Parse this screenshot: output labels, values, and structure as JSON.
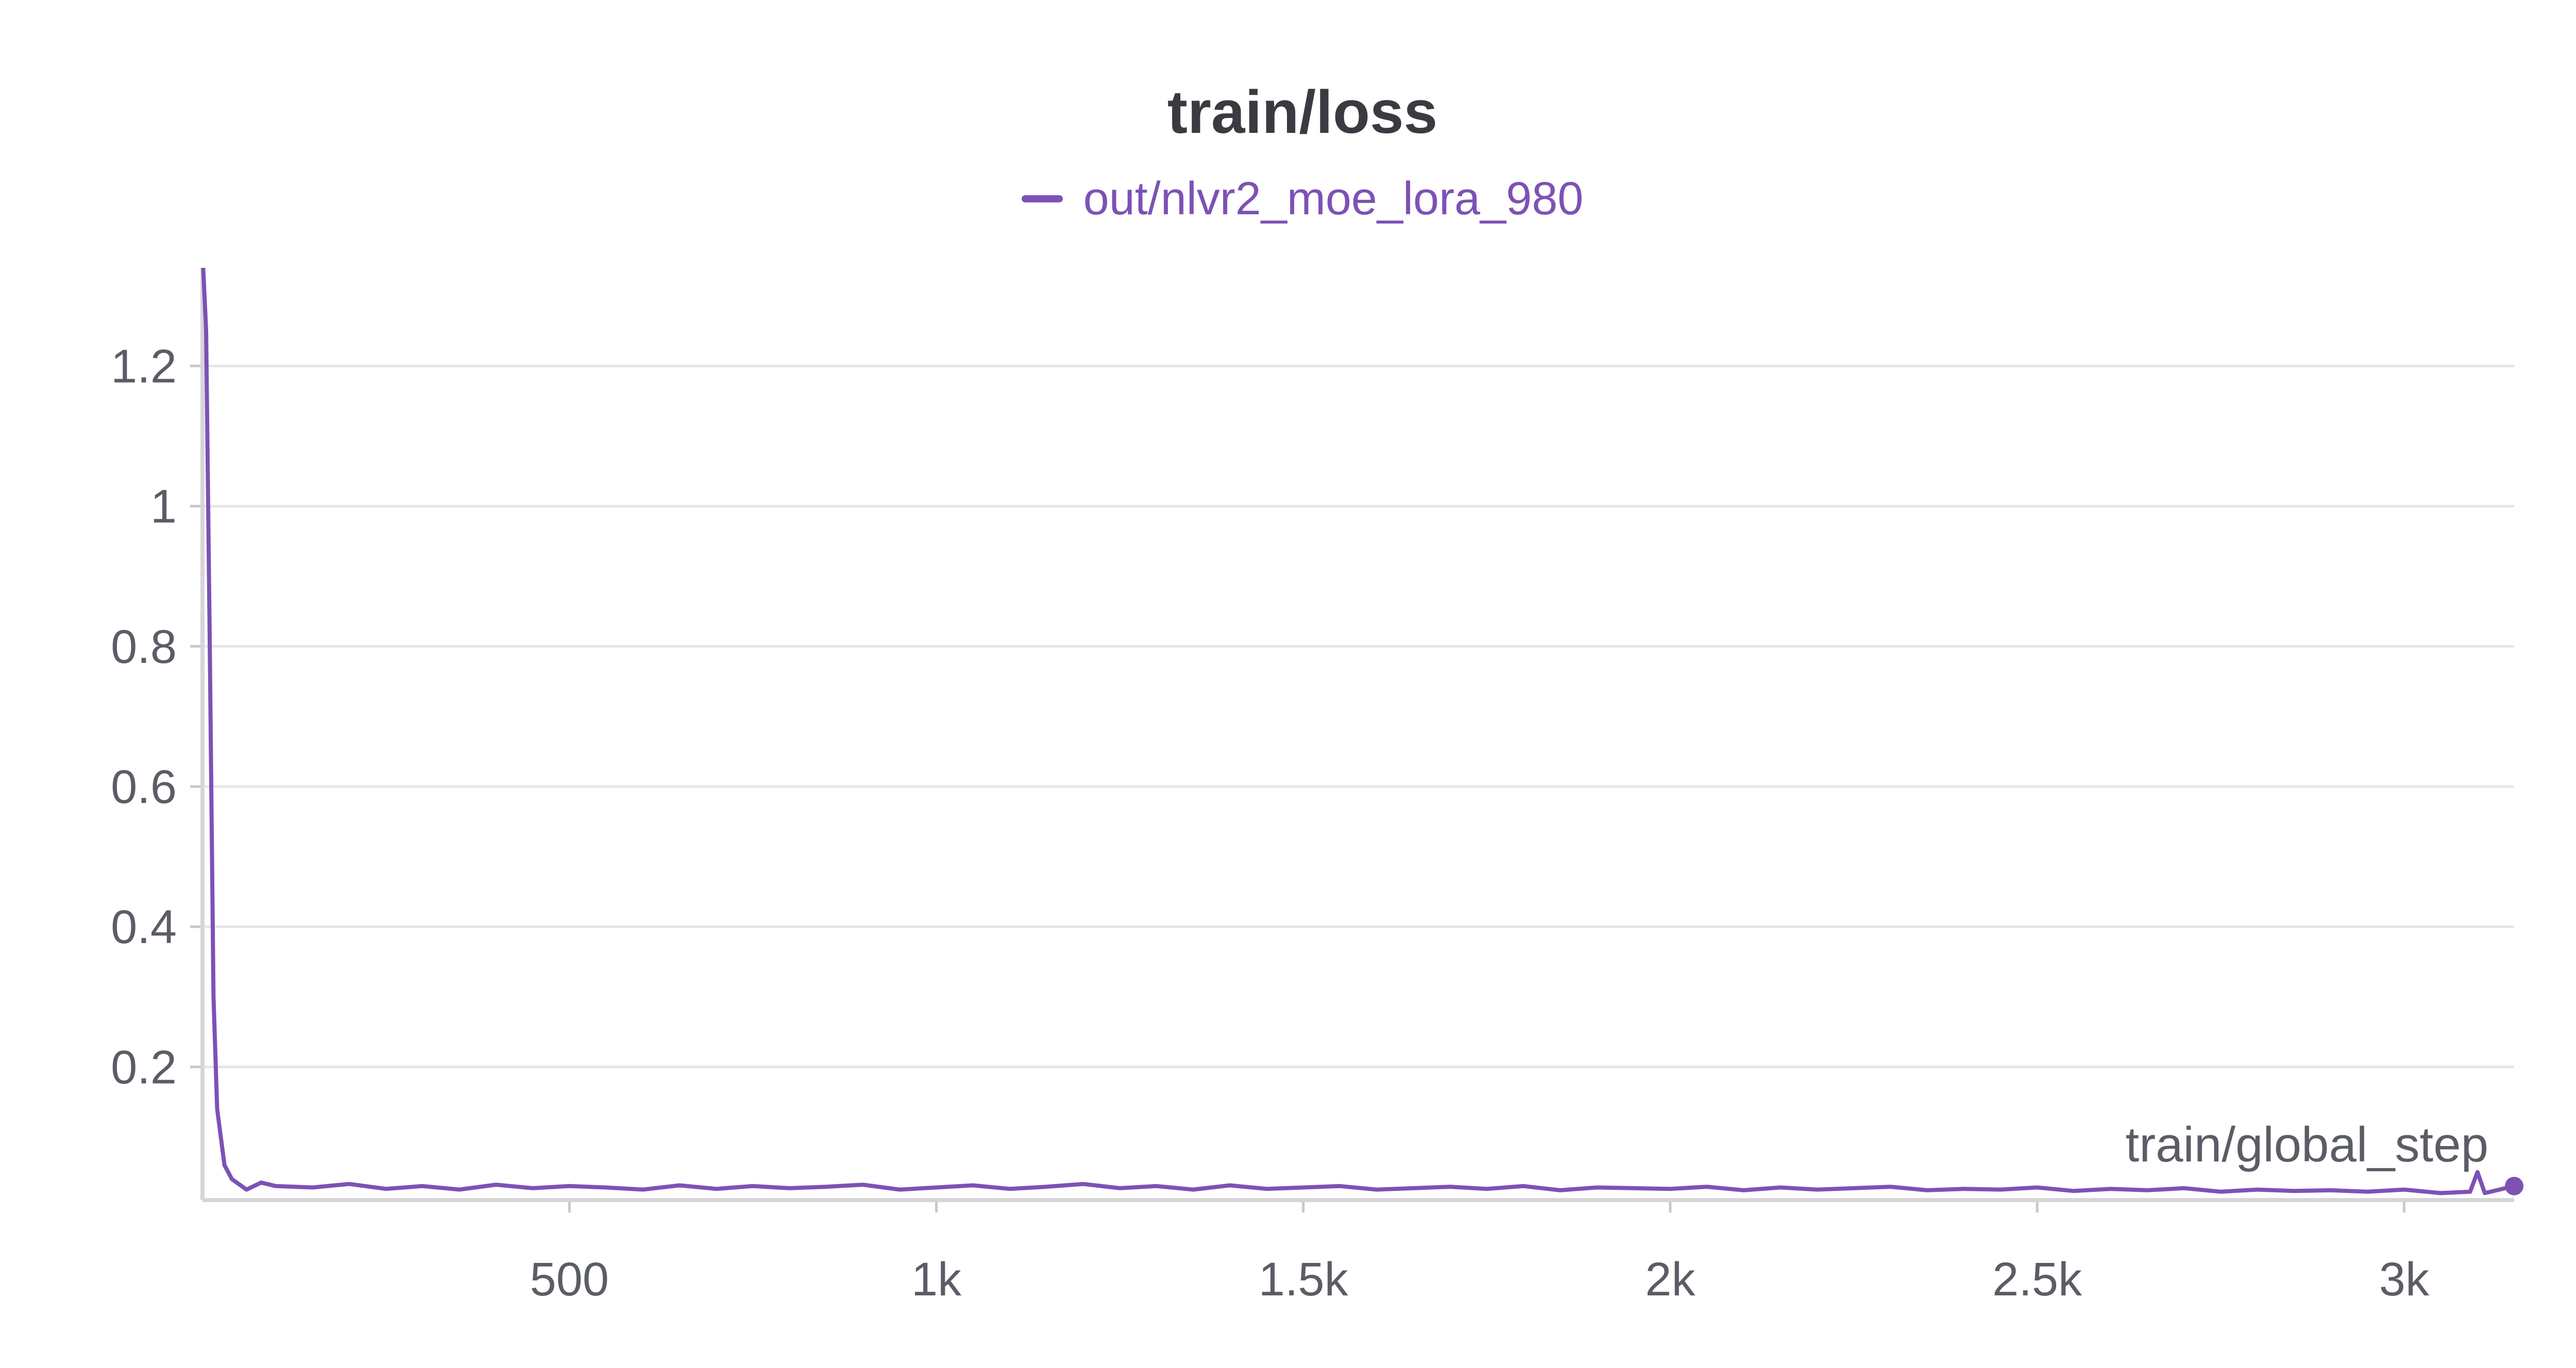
{
  "chart_data": {
    "type": "line",
    "title": "train/loss",
    "xlabel": "train/global_step",
    "ylabel": "",
    "xlim": [
      0,
      3150
    ],
    "ylim": [
      0.01,
      1.34
    ],
    "x_ticks": [
      500,
      1000,
      1500,
      2000,
      2500,
      3000
    ],
    "x_tick_labels": [
      "500",
      "1k",
      "1.5k",
      "2k",
      "2.5k",
      "3k"
    ],
    "y_ticks": [
      0.2,
      0.4,
      0.6,
      0.8,
      1.0,
      1.2
    ],
    "y_tick_labels": [
      "0.2",
      "0.4",
      "0.6",
      "0.8",
      "1",
      "1.2"
    ],
    "grid": "horizontal",
    "legend_position": "top-center",
    "series": [
      {
        "name": "out/nlvr2_moe_lora_980",
        "color": "#7c52b5",
        "x": [
          1,
          5,
          10,
          15,
          20,
          30,
          40,
          60,
          80,
          100,
          150,
          200,
          250,
          300,
          350,
          400,
          450,
          500,
          550,
          600,
          650,
          700,
          750,
          800,
          850,
          900,
          950,
          1000,
          1050,
          1100,
          1150,
          1200,
          1250,
          1300,
          1350,
          1400,
          1450,
          1500,
          1550,
          1600,
          1650,
          1700,
          1750,
          1800,
          1850,
          1900,
          1950,
          2000,
          2050,
          2100,
          2150,
          2200,
          2250,
          2300,
          2350,
          2400,
          2450,
          2500,
          2550,
          2600,
          2650,
          2700,
          2750,
          2800,
          2850,
          2900,
          2950,
          3000,
          3050,
          3090,
          3100,
          3110,
          3150
        ],
        "values": [
          1.34,
          1.25,
          0.8,
          0.3,
          0.14,
          0.06,
          0.04,
          0.025,
          0.035,
          0.03,
          0.028,
          0.033,
          0.026,
          0.03,
          0.025,
          0.032,
          0.027,
          0.03,
          0.028,
          0.025,
          0.031,
          0.026,
          0.03,
          0.027,
          0.029,
          0.032,
          0.025,
          0.028,
          0.031,
          0.026,
          0.029,
          0.033,
          0.027,
          0.03,
          0.025,
          0.031,
          0.026,
          0.028,
          0.03,
          0.025,
          0.027,
          0.029,
          0.026,
          0.03,
          0.024,
          0.028,
          0.027,
          0.026,
          0.029,
          0.024,
          0.028,
          0.025,
          0.027,
          0.029,
          0.024,
          0.026,
          0.025,
          0.028,
          0.023,
          0.026,
          0.024,
          0.027,
          0.022,
          0.025,
          0.023,
          0.024,
          0.022,
          0.025,
          0.02,
          0.022,
          0.05,
          0.02,
          0.03
        ]
      }
    ]
  }
}
